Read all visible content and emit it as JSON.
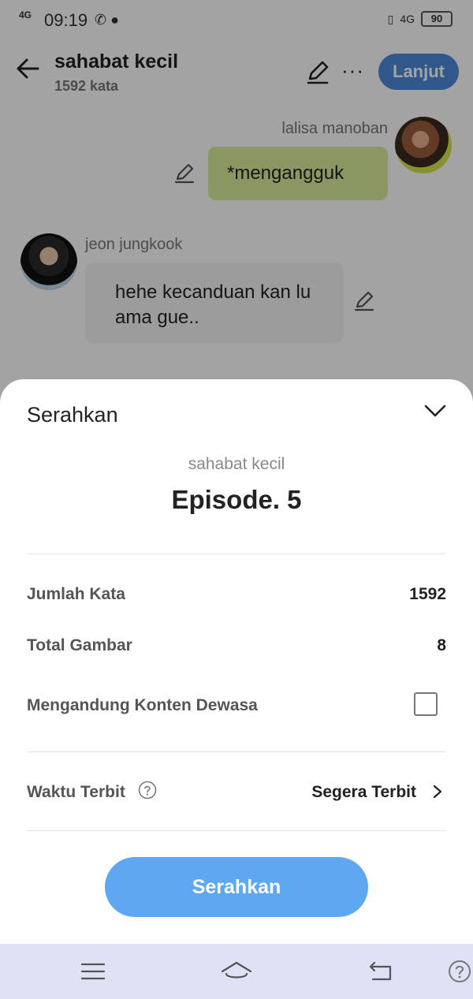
{
  "status_bar": {
    "network": "4G",
    "time": "09:19",
    "right_network": "4G",
    "battery": "90"
  },
  "header": {
    "story_title": "sahabat kecil",
    "word_count": "1592 kata",
    "next_label": "Lanjut",
    "more_label": "···"
  },
  "chat": {
    "messages": [
      {
        "sender": "lalisa manoban",
        "text": "*mengangguk",
        "side": "right"
      },
      {
        "sender": "jeon jungkook",
        "text": "hehe kecanduan kan lu ama gue..",
        "side": "left"
      }
    ]
  },
  "sheet": {
    "title": "Serahkan",
    "story_name": "sahabat kecil",
    "episode": "Episode. 5",
    "rows": [
      {
        "label": "Jumlah Kata",
        "value": "1592"
      },
      {
        "label": "Total Gambar",
        "value": "8"
      },
      {
        "label": "Mengandung Konten Dewasa",
        "checked": false
      }
    ],
    "publish_time": {
      "label": "Waktu Terbit",
      "value": "Segera Terbit"
    },
    "submit_label": "Serahkan"
  },
  "colors": {
    "primary_button": "#5ea8f2",
    "next_button": "#4b8ad8",
    "bubble_right": "#d9ed9c",
    "nav_bar": "#dfe2f4"
  }
}
